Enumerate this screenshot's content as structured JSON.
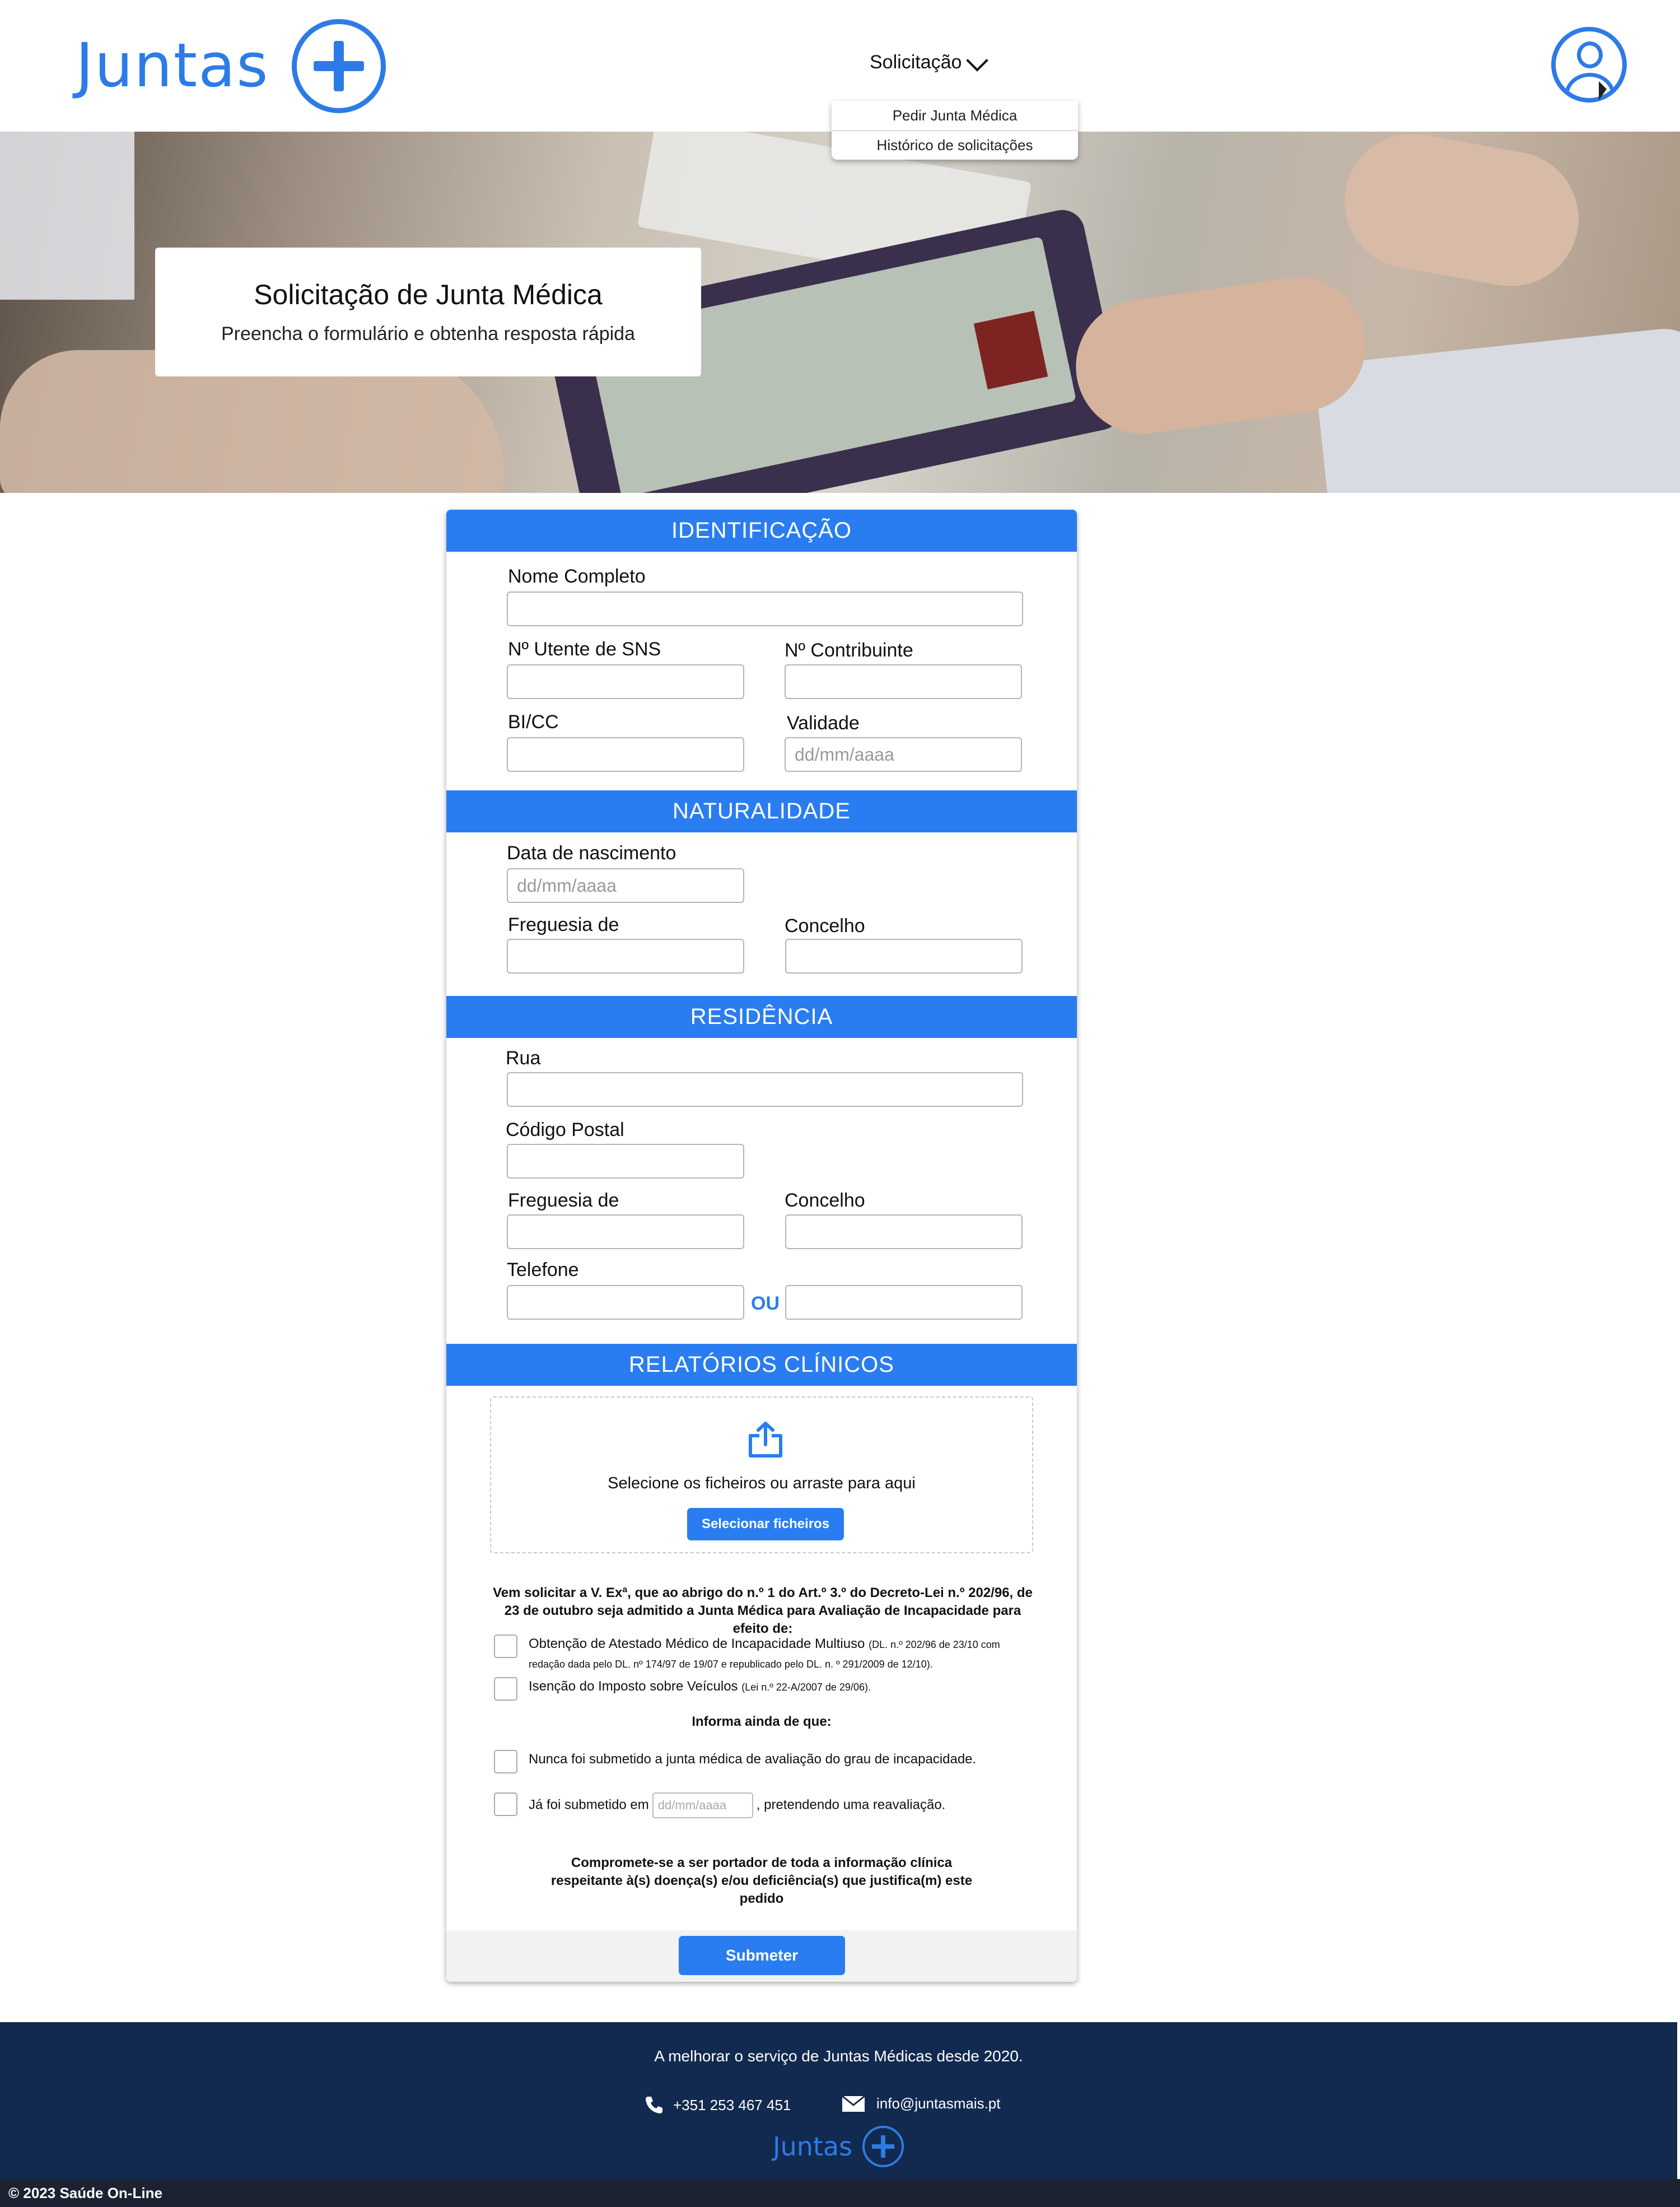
{
  "header": {
    "logo_text": "Juntas",
    "nav_label": "Solicitação",
    "dropdown_items": [
      "Pedir Junta Médica",
      "Histórico de solicitações"
    ],
    "accent_color": "#2d7be6"
  },
  "hero": {
    "title": "Solicitação de Junta Médica",
    "subtitle": "Preencha o formulário e obtenha resposta rápida"
  },
  "form": {
    "identificacao": {
      "heading": "IDENTIFICAÇÃO",
      "nome_label": "Nome Completo",
      "sns_label": "Nº Utente de SNS",
      "contribuinte_label": "Nº Contribuinte",
      "bicc_label": "BI/CC",
      "validade_label": "Validade",
      "validade_placeholder": "dd/mm/aaaa"
    },
    "naturalidade": {
      "heading": "NATURALIDADE",
      "nascimento_label": "Data de nascimento",
      "nascimento_placeholder": "dd/mm/aaaa",
      "freguesia_label": "Freguesia de",
      "concelho_label": "Concelho"
    },
    "residencia": {
      "heading": "RESIDÊNCIA",
      "rua_label": "Rua",
      "codigo_postal_label": "Código Postal",
      "freguesia_label": "Freguesia de",
      "concelho_label": "Concelho",
      "telefone_label": "Telefone",
      "ou": "OU"
    },
    "relatorios": {
      "heading": "RELATÓRIOS CLÍNICOS",
      "drop_text": "Selecione os ficheiros ou arraste para aqui",
      "select_button": "Selecionar ficheiros"
    },
    "declaration": "Vem solicitar a V. Exª, que ao abrigo do n.º 1 do Art.º 3.º do Decreto-Lei n.º 202/96, de 23 de outubro seja admitido a Junta Médica para Avaliação de Incapacidade para efeito de:",
    "option1_text": "Obtenção de Atestado Médico de Incapacidade Multiuso",
    "option1_note": "(DL. n.º 202/96 de 23/10 com redação dada pelo DL. nº 174/97 de 19/07 e republicado pelo DL. n. º 291/2009 de 12/10).",
    "option2_text": "Isenção do Imposto sobre Veículos",
    "option2_note": "(Lei n.º 22-A/2007 de 29/06).",
    "info_heading": "Informa ainda de que:",
    "option3_text": "Nunca foi submetido a junta médica de avaliação do grau de incapacidade.",
    "option4_pre": "Já foi submetido em",
    "option4_placeholder": "dd/mm/aaaa",
    "option4_post": ", pretendendo uma reavaliação.",
    "commitment": "Compromete-se a ser portador de toda a informação clínica respeitante à(s) doença(s) e/ou deficiência(s) que justifica(m) este pedido",
    "submit_label": "Submeter"
  },
  "footer": {
    "tagline": "A melhorar o serviço de Juntas Médicas desde 2020.",
    "phone": "+351 253 467 451",
    "email": "info@juntasmais.pt",
    "logo_text": "Juntas",
    "copyright": "© 2023 Saúde On-Line",
    "background_color": "#122a50"
  }
}
